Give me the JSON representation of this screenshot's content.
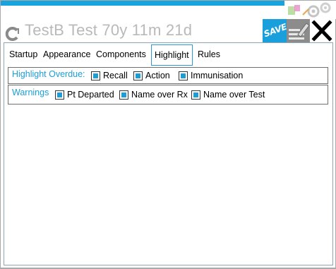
{
  "window": {
    "title": "TestB Test 70y 11m 21d"
  },
  "toolbar": {
    "save_label": "SAVE",
    "edit_icon": "edit-icon",
    "close_icon": "close-icon"
  },
  "colors": {
    "accent": "#16a3de",
    "check_fill": "#1f9bd6",
    "group_label": "#1b9ed8",
    "title": "#b9b9b9"
  },
  "tabs": [
    {
      "label": "Startup"
    },
    {
      "label": "Appearance"
    },
    {
      "label": "Components"
    },
    {
      "label": "Highlight",
      "active": true
    },
    {
      "label": "Rules"
    }
  ],
  "highlight": {
    "overdue": {
      "label": "Highlight Overdue:",
      "options": [
        {
          "label": "Recall",
          "checked": true
        },
        {
          "label": "Action",
          "checked": true
        },
        {
          "label": "Immunisation",
          "checked": true
        }
      ]
    },
    "warnings": {
      "label": "Warnings",
      "options": [
        {
          "label": "Pt Departed",
          "checked": true
        },
        {
          "label": "Name over Rx",
          "checked": true
        },
        {
          "label": "Name over Test",
          "checked": true
        }
      ]
    }
  }
}
